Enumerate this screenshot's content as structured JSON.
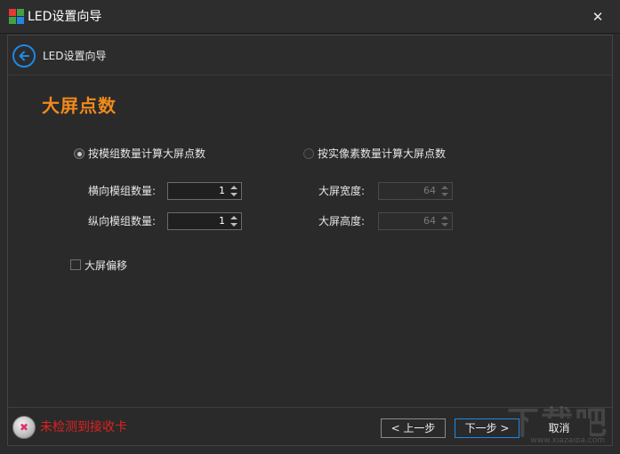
{
  "window": {
    "title": "LED设置向导"
  },
  "header": {
    "title": "LED设置向导"
  },
  "section": {
    "title": "大屏点数"
  },
  "options": {
    "by_module": "按模组数量计算大屏点数",
    "by_pixel": "按实像素数量计算大屏点数"
  },
  "fields": {
    "h_modules_label": "横向模组数量:",
    "h_modules_value": "1",
    "v_modules_label": "纵向模组数量:",
    "v_modules_value": "1",
    "width_label": "大屏宽度:",
    "width_value": "64",
    "height_label": "大屏高度:",
    "height_value": "64"
  },
  "offset": {
    "label": "大屏偏移"
  },
  "status": {
    "text": "未检测到接收卡"
  },
  "buttons": {
    "prev": "< 上一步",
    "next": "下一步 >",
    "cancel": "取消"
  },
  "watermark": {
    "text": "下载吧",
    "sub": "www.xiazaiba.com"
  },
  "colors": {
    "accent": "#1e88e5",
    "title_orange": "#f08a1c",
    "error_red": "#e02020",
    "background": "#2b2b2b"
  }
}
